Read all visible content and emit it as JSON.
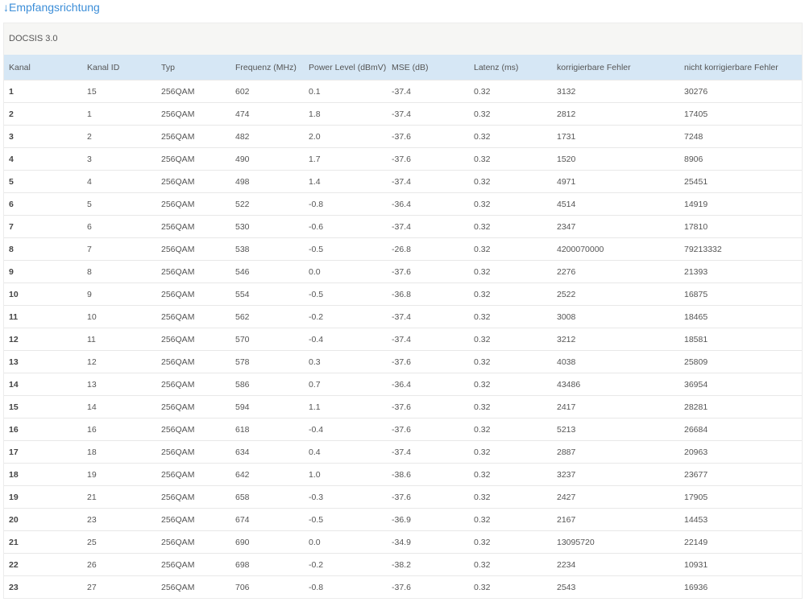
{
  "section": {
    "arrow_icon": "arrow-down-icon",
    "arrow": "↓",
    "title": "Empfangsrichtung"
  },
  "table": {
    "caption": "DOCSIS 3.0",
    "accent_color": "#3c8ed8",
    "header_color": "#d6e7f5",
    "columns": [
      "Kanal",
      "Kanal ID",
      "Typ",
      "Frequenz (MHz)",
      "Power Level (dBmV)",
      "MSE (dB)",
      "Latenz (ms)",
      "korrigierbare Fehler",
      "nicht korrigierbare Fehler"
    ],
    "rows": [
      [
        "1",
        "15",
        "256QAM",
        "602",
        "0.1",
        "-37.4",
        "0.32",
        "3132",
        "30276"
      ],
      [
        "2",
        "1",
        "256QAM",
        "474",
        "1.8",
        "-37.4",
        "0.32",
        "2812",
        "17405"
      ],
      [
        "3",
        "2",
        "256QAM",
        "482",
        "2.0",
        "-37.6",
        "0.32",
        "1731",
        "7248"
      ],
      [
        "4",
        "3",
        "256QAM",
        "490",
        "1.7",
        "-37.6",
        "0.32",
        "1520",
        "8906"
      ],
      [
        "5",
        "4",
        "256QAM",
        "498",
        "1.4",
        "-37.4",
        "0.32",
        "4971",
        "25451"
      ],
      [
        "6",
        "5",
        "256QAM",
        "522",
        "-0.8",
        "-36.4",
        "0.32",
        "4514",
        "14919"
      ],
      [
        "7",
        "6",
        "256QAM",
        "530",
        "-0.6",
        "-37.4",
        "0.32",
        "2347",
        "17810"
      ],
      [
        "8",
        "7",
        "256QAM",
        "538",
        "-0.5",
        "-26.8",
        "0.32",
        "4200070000",
        "79213332"
      ],
      [
        "9",
        "8",
        "256QAM",
        "546",
        "0.0",
        "-37.6",
        "0.32",
        "2276",
        "21393"
      ],
      [
        "10",
        "9",
        "256QAM",
        "554",
        "-0.5",
        "-36.8",
        "0.32",
        "2522",
        "16875"
      ],
      [
        "11",
        "10",
        "256QAM",
        "562",
        "-0.2",
        "-37.4",
        "0.32",
        "3008",
        "18465"
      ],
      [
        "12",
        "11",
        "256QAM",
        "570",
        "-0.4",
        "-37.4",
        "0.32",
        "3212",
        "18581"
      ],
      [
        "13",
        "12",
        "256QAM",
        "578",
        "0.3",
        "-37.6",
        "0.32",
        "4038",
        "25809"
      ],
      [
        "14",
        "13",
        "256QAM",
        "586",
        "0.7",
        "-36.4",
        "0.32",
        "43486",
        "36954"
      ],
      [
        "15",
        "14",
        "256QAM",
        "594",
        "1.1",
        "-37.6",
        "0.32",
        "2417",
        "28281"
      ],
      [
        "16",
        "16",
        "256QAM",
        "618",
        "-0.4",
        "-37.6",
        "0.32",
        "5213",
        "26684"
      ],
      [
        "17",
        "18",
        "256QAM",
        "634",
        "0.4",
        "-37.4",
        "0.32",
        "2887",
        "20963"
      ],
      [
        "18",
        "19",
        "256QAM",
        "642",
        "1.0",
        "-38.6",
        "0.32",
        "3237",
        "23677"
      ],
      [
        "19",
        "21",
        "256QAM",
        "658",
        "-0.3",
        "-37.6",
        "0.32",
        "2427",
        "17905"
      ],
      [
        "20",
        "23",
        "256QAM",
        "674",
        "-0.5",
        "-36.9",
        "0.32",
        "2167",
        "14453"
      ],
      [
        "21",
        "25",
        "256QAM",
        "690",
        "0.0",
        "-34.9",
        "0.32",
        "13095720",
        "22149"
      ],
      [
        "22",
        "26",
        "256QAM",
        "698",
        "-0.2",
        "-38.2",
        "0.32",
        "2234",
        "10931"
      ],
      [
        "23",
        "27",
        "256QAM",
        "706",
        "-0.8",
        "-37.6",
        "0.32",
        "2543",
        "16936"
      ]
    ]
  }
}
